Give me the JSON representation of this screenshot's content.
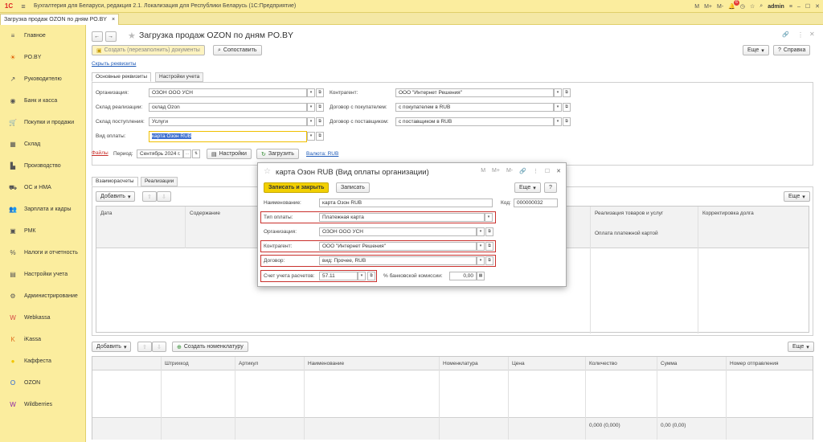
{
  "app": {
    "title": "Бухгалтерия для Беларуси, редакция 2.1. Локализация для Республики Беларусь (1С:Предприятие)",
    "user": "admin",
    "notifications": "6",
    "m_buttons": [
      "M",
      "M+",
      "M-"
    ]
  },
  "doc_tab": {
    "label": "Загрузка продаж OZON по дням PO.BY",
    "close": "×"
  },
  "sidebar": {
    "items": [
      {
        "label": "Главное",
        "icon": "menu-icon"
      },
      {
        "label": "PO.BY",
        "icon": "sun-icon"
      },
      {
        "label": "Руководителю",
        "icon": "chart-icon"
      },
      {
        "label": "Банк и касса",
        "icon": "coin-icon"
      },
      {
        "label": "Покупки и продажи",
        "icon": "cart-icon"
      },
      {
        "label": "Склад",
        "icon": "warehouse-icon"
      },
      {
        "label": "Производство",
        "icon": "factory-icon"
      },
      {
        "label": "ОС и НМА",
        "icon": "truck-icon"
      },
      {
        "label": "Зарплата и кадры",
        "icon": "people-icon"
      },
      {
        "label": "РМК",
        "icon": "register-icon"
      },
      {
        "label": "Налоги и отчетность",
        "icon": "percent-icon"
      },
      {
        "label": "Настройки учета",
        "icon": "book-icon"
      },
      {
        "label": "Администрирование",
        "icon": "gear-icon"
      },
      {
        "label": "Webkassa",
        "icon": "webkassa-icon"
      },
      {
        "label": "iKassa",
        "icon": "ikassa-icon"
      },
      {
        "label": "Каффеста",
        "icon": "kaffesta-icon"
      },
      {
        "label": "OZON",
        "icon": "ozon-icon"
      },
      {
        "label": "Wildberries",
        "icon": "wildberries-icon"
      }
    ]
  },
  "form": {
    "title": "Загрузка продаж OZON по дням PO.BY",
    "create_button": "Создать (перезаполнить) документы",
    "match_button": "Сопоставить",
    "more": "Еще",
    "help": "Справка",
    "hide_link": "Скрыть реквизиты",
    "tabs": [
      "Основные реквизиты",
      "Настройки учета"
    ],
    "org_label": "Организация:",
    "org_value": "ОЗОН ООО УСН",
    "warehouse_sale_label": "Склад реализации:",
    "warehouse_sale_value": "склад Ozon",
    "warehouse_in_label": "Склад поступления:",
    "warehouse_in_value": "Услуги",
    "payment_label": "Вид оплаты:",
    "payment_value": "карта Озон RUB",
    "contractor_label": "Контрагент:",
    "contractor_value": "ООО \"Интернет Решения\"",
    "buyer_contract_label": "Договор с покупателем:",
    "buyer_contract_value": "с покупателем в RUB",
    "supplier_contract_label": "Договор с поставщиком:",
    "supplier_contract_value": "с поставщиком в RUB",
    "files_link": "Файлы",
    "period_label": "Период:",
    "period_value": "Сентябрь 2024 г.",
    "settings_button": "Настройки",
    "load_button": "Загрузить",
    "currency_link": "Валюта: RUB",
    "lower_tabs": [
      "Взаиморасчеты",
      "Реализации"
    ],
    "add_button": "Добавить",
    "create_nomen_button": "Создать номенклатуру",
    "grid1_headers": [
      "Дата",
      "Содержание"
    ],
    "grid1_right_headers": [
      "Реализация товаров и услуг",
      "Корректировка долга",
      "Оплата платежной картой"
    ],
    "grid2_headers": [
      "Штрихкод",
      "Артикул",
      "Наименование",
      "Номенклатура",
      "Цена",
      "Количество",
      "Сумма",
      "Номер отправления"
    ],
    "grid2_total_qty": "0,000 (0,000)",
    "grid2_total_sum": "0,00 (0,00)"
  },
  "modal": {
    "title": "карта Озон RUB (Вид оплаты организации)",
    "save_close": "Записать и закрыть",
    "save": "Записать",
    "more": "Еще",
    "help": "?",
    "name_label": "Наименование:",
    "name_value": "карта Озон RUB",
    "code_label": "Код:",
    "code_value": "000000032",
    "type_label": "Тип оплаты:",
    "type_value": "Платежная карта",
    "org_label": "Организация:",
    "org_value": "ОЗОН ООО УСН",
    "contractor_label": "Контрагент:",
    "contractor_value": "ООО \"Интернет Решения\"",
    "contract_label": "Договор:",
    "contract_value": "вид: Прочее, RUB",
    "account_label": "Счет учета расчетов:",
    "account_value": "57.11",
    "commission_label": "% банковской комиссии:",
    "commission_value": "0,00"
  }
}
